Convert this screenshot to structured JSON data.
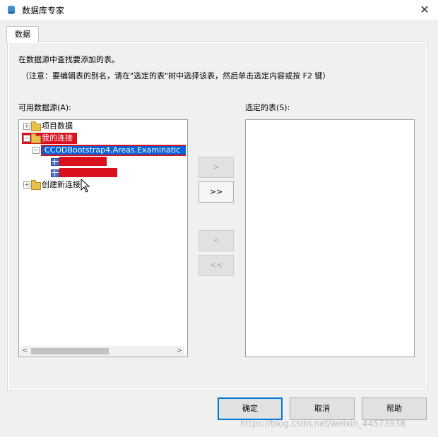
{
  "window": {
    "title": "数据库专家",
    "close_glyph": "✕",
    "icon": "database-expert-icon"
  },
  "tabs": [
    {
      "label": "数据"
    }
  ],
  "instructions": {
    "line1": "在数据源中查找要添加的表。",
    "line2": "（注意：要编辑表的别名，请在\"选定的表\"树中选择该表，然后单击选定内容或按 F2 键）"
  },
  "available": {
    "label": "可用数据源(A):",
    "tree": {
      "project_data": "项目数据",
      "my_connections": "我的连接",
      "connection": "CCODBootstrap4.Areas.Examinatic",
      "create_new_connection": "创建新连接"
    },
    "scroll_left": "<",
    "scroll_right": ">"
  },
  "selected": {
    "label": "选定的表(S):"
  },
  "move_buttons": {
    "add": ">",
    "add_all": ">>",
    "remove": "<",
    "remove_all": "<<"
  },
  "dialog_buttons": {
    "ok": "确定",
    "cancel": "取消",
    "help": "帮助"
  },
  "watermark": "https://blog.csdn.net/weixin_44573938",
  "colors": {
    "redaction": "#d9111e",
    "selection": "#0a62d6",
    "default_button_border": "#0078d7"
  }
}
